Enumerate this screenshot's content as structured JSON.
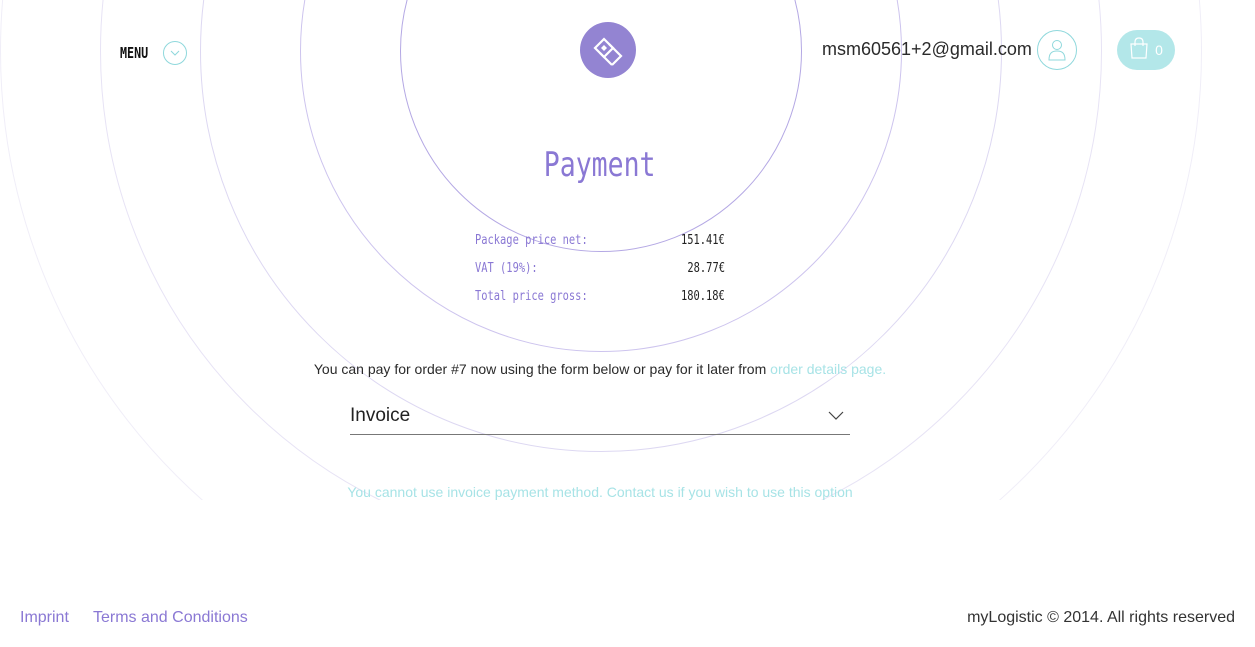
{
  "header": {
    "menu_label": "MENU",
    "user_email": "msm60561+2@gmail.com",
    "cart_count": "0"
  },
  "payment": {
    "title": "Payment",
    "rows": [
      {
        "label": "Package price net:",
        "value": "151.41€"
      },
      {
        "label": "VAT (19%):",
        "value": "28.77€"
      },
      {
        "label": "Total price gross:",
        "value": "180.18€"
      }
    ],
    "note_text": "You can pay for order #7 now using the form below or pay for it later from ",
    "note_link": "order details page.",
    "method_selected": "Invoice",
    "warning": "You cannot use invoice payment method. Contact us if you wish to use this option"
  },
  "footer": {
    "imprint": "Imprint",
    "terms": "Terms and Conditions",
    "copyright": "myLogistic © 2014. All rights reserved"
  },
  "colors": {
    "accent_purple": "#8a78d4",
    "accent_teal": "#a7e3e6",
    "logo_bg": "#9384d2"
  },
  "icons": {
    "menu": "chevron-down-icon",
    "logo": "logo-icon",
    "user": "user-icon",
    "cart": "shopping-bag-icon",
    "select": "chevron-down-icon"
  }
}
